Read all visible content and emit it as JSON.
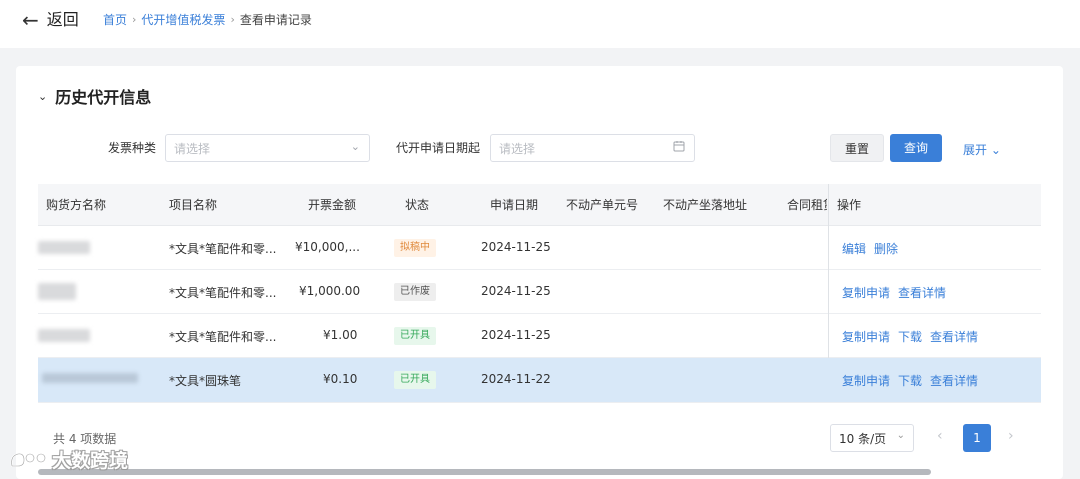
{
  "header": {
    "back_icon": "arrow-left-icon",
    "back_label": "返回",
    "breadcrumb": [
      "首页",
      "代开增值税发票",
      "查看申请记录"
    ],
    "separator_icon": "chevron-right-icon"
  },
  "section": {
    "title": "历史代开信息",
    "toggle_icon": "chevron-down-icon"
  },
  "filters": {
    "invoice_type": {
      "label": "发票种类",
      "placeholder": "请选择",
      "icon": "chevron-down-icon"
    },
    "apply_date": {
      "label": "代开申请日期起",
      "placeholder": "请选择",
      "icon": "calendar-icon"
    },
    "reset_label": "重置",
    "query_label": "查询",
    "expand_label": "展开",
    "expand_icon": "chevron-down-icon"
  },
  "table": {
    "columns": [
      "购货方名称",
      "项目名称",
      "开票金额",
      "状态",
      "申请日期",
      "不动产单元号",
      "不动产坐落地址",
      "合同租赁",
      "操作"
    ],
    "rows": [
      {
        "buyer": "",
        "item": "*文具*笔配件和零...",
        "amount": "¥10,000,...",
        "status": "拟稿中",
        "status_type": "draft",
        "date": "2024-11-25",
        "actions": [
          "编辑",
          "删除"
        ],
        "selected": false
      },
      {
        "buyer": "",
        "item": "*文具*笔配件和零...",
        "amount": "¥1,000.00",
        "status": "已作废",
        "status_type": "void",
        "date": "2024-11-25",
        "actions": [
          "复制申请",
          "查看详情"
        ],
        "selected": false
      },
      {
        "buyer": "",
        "item": "*文具*笔配件和零...",
        "amount": "¥1.00",
        "status": "已开具",
        "status_type": "done",
        "date": "2024-11-25",
        "actions": [
          "复制申请",
          "下载",
          "查看详情"
        ],
        "selected": false
      },
      {
        "buyer": "",
        "item": "*文具*圆珠笔",
        "amount": "¥0.10",
        "status": "已开具",
        "status_type": "done",
        "date": "2024-11-22",
        "actions": [
          "复制申请",
          "下载",
          "查看详情"
        ],
        "selected": true
      }
    ],
    "colors": {
      "accent": "#3a7fd8",
      "selected_row": "#d8e8f8",
      "draft": "#e08a3c",
      "done": "#36a85a"
    }
  },
  "pagination": {
    "total_text": "共 4 项数据",
    "page_size": "10 条/页",
    "page_size_icon": "chevron-down-icon",
    "prev_icon": "chevron-left-icon",
    "next_icon": "chevron-right-icon",
    "current_page": "1"
  },
  "watermark": {
    "text": "大数跨境",
    "icon": "brand-logo-icon"
  }
}
